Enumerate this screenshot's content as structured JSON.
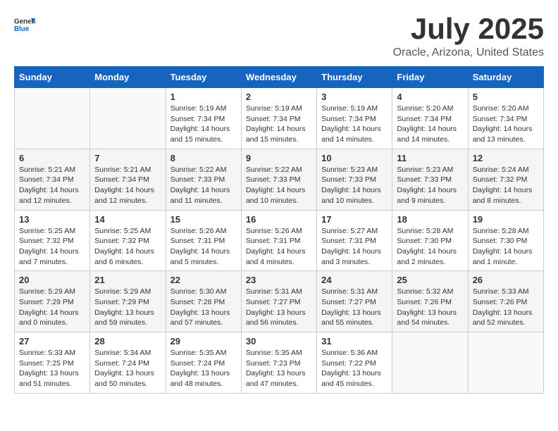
{
  "header": {
    "logo_general": "General",
    "logo_blue": "Blue",
    "month": "July 2025",
    "location": "Oracle, Arizona, United States"
  },
  "calendar": {
    "days_of_week": [
      "Sunday",
      "Monday",
      "Tuesday",
      "Wednesday",
      "Thursday",
      "Friday",
      "Saturday"
    ],
    "weeks": [
      [
        {
          "day": "",
          "info": ""
        },
        {
          "day": "",
          "info": ""
        },
        {
          "day": "1",
          "info": "Sunrise: 5:19 AM\nSunset: 7:34 PM\nDaylight: 14 hours\nand 15 minutes."
        },
        {
          "day": "2",
          "info": "Sunrise: 5:19 AM\nSunset: 7:34 PM\nDaylight: 14 hours\nand 15 minutes."
        },
        {
          "day": "3",
          "info": "Sunrise: 5:19 AM\nSunset: 7:34 PM\nDaylight: 14 hours\nand 14 minutes."
        },
        {
          "day": "4",
          "info": "Sunrise: 5:20 AM\nSunset: 7:34 PM\nDaylight: 14 hours\nand 14 minutes."
        },
        {
          "day": "5",
          "info": "Sunrise: 5:20 AM\nSunset: 7:34 PM\nDaylight: 14 hours\nand 13 minutes."
        }
      ],
      [
        {
          "day": "6",
          "info": "Sunrise: 5:21 AM\nSunset: 7:34 PM\nDaylight: 14 hours\nand 12 minutes."
        },
        {
          "day": "7",
          "info": "Sunrise: 5:21 AM\nSunset: 7:34 PM\nDaylight: 14 hours\nand 12 minutes."
        },
        {
          "day": "8",
          "info": "Sunrise: 5:22 AM\nSunset: 7:33 PM\nDaylight: 14 hours\nand 11 minutes."
        },
        {
          "day": "9",
          "info": "Sunrise: 5:22 AM\nSunset: 7:33 PM\nDaylight: 14 hours\nand 10 minutes."
        },
        {
          "day": "10",
          "info": "Sunrise: 5:23 AM\nSunset: 7:33 PM\nDaylight: 14 hours\nand 10 minutes."
        },
        {
          "day": "11",
          "info": "Sunrise: 5:23 AM\nSunset: 7:33 PM\nDaylight: 14 hours\nand 9 minutes."
        },
        {
          "day": "12",
          "info": "Sunrise: 5:24 AM\nSunset: 7:32 PM\nDaylight: 14 hours\nand 8 minutes."
        }
      ],
      [
        {
          "day": "13",
          "info": "Sunrise: 5:25 AM\nSunset: 7:32 PM\nDaylight: 14 hours\nand 7 minutes."
        },
        {
          "day": "14",
          "info": "Sunrise: 5:25 AM\nSunset: 7:32 PM\nDaylight: 14 hours\nand 6 minutes."
        },
        {
          "day": "15",
          "info": "Sunrise: 5:26 AM\nSunset: 7:31 PM\nDaylight: 14 hours\nand 5 minutes."
        },
        {
          "day": "16",
          "info": "Sunrise: 5:26 AM\nSunset: 7:31 PM\nDaylight: 14 hours\nand 4 minutes."
        },
        {
          "day": "17",
          "info": "Sunrise: 5:27 AM\nSunset: 7:31 PM\nDaylight: 14 hours\nand 3 minutes."
        },
        {
          "day": "18",
          "info": "Sunrise: 5:28 AM\nSunset: 7:30 PM\nDaylight: 14 hours\nand 2 minutes."
        },
        {
          "day": "19",
          "info": "Sunrise: 5:28 AM\nSunset: 7:30 PM\nDaylight: 14 hours\nand 1 minute."
        }
      ],
      [
        {
          "day": "20",
          "info": "Sunrise: 5:29 AM\nSunset: 7:29 PM\nDaylight: 14 hours\nand 0 minutes."
        },
        {
          "day": "21",
          "info": "Sunrise: 5:29 AM\nSunset: 7:29 PM\nDaylight: 13 hours\nand 59 minutes."
        },
        {
          "day": "22",
          "info": "Sunrise: 5:30 AM\nSunset: 7:28 PM\nDaylight: 13 hours\nand 57 minutes."
        },
        {
          "day": "23",
          "info": "Sunrise: 5:31 AM\nSunset: 7:27 PM\nDaylight: 13 hours\nand 56 minutes."
        },
        {
          "day": "24",
          "info": "Sunrise: 5:31 AM\nSunset: 7:27 PM\nDaylight: 13 hours\nand 55 minutes."
        },
        {
          "day": "25",
          "info": "Sunrise: 5:32 AM\nSunset: 7:26 PM\nDaylight: 13 hours\nand 54 minutes."
        },
        {
          "day": "26",
          "info": "Sunrise: 5:33 AM\nSunset: 7:26 PM\nDaylight: 13 hours\nand 52 minutes."
        }
      ],
      [
        {
          "day": "27",
          "info": "Sunrise: 5:33 AM\nSunset: 7:25 PM\nDaylight: 13 hours\nand 51 minutes."
        },
        {
          "day": "28",
          "info": "Sunrise: 5:34 AM\nSunset: 7:24 PM\nDaylight: 13 hours\nand 50 minutes."
        },
        {
          "day": "29",
          "info": "Sunrise: 5:35 AM\nSunset: 7:24 PM\nDaylight: 13 hours\nand 48 minutes."
        },
        {
          "day": "30",
          "info": "Sunrise: 5:35 AM\nSunset: 7:23 PM\nDaylight: 13 hours\nand 47 minutes."
        },
        {
          "day": "31",
          "info": "Sunrise: 5:36 AM\nSunset: 7:22 PM\nDaylight: 13 hours\nand 45 minutes."
        },
        {
          "day": "",
          "info": ""
        },
        {
          "day": "",
          "info": ""
        }
      ]
    ]
  }
}
